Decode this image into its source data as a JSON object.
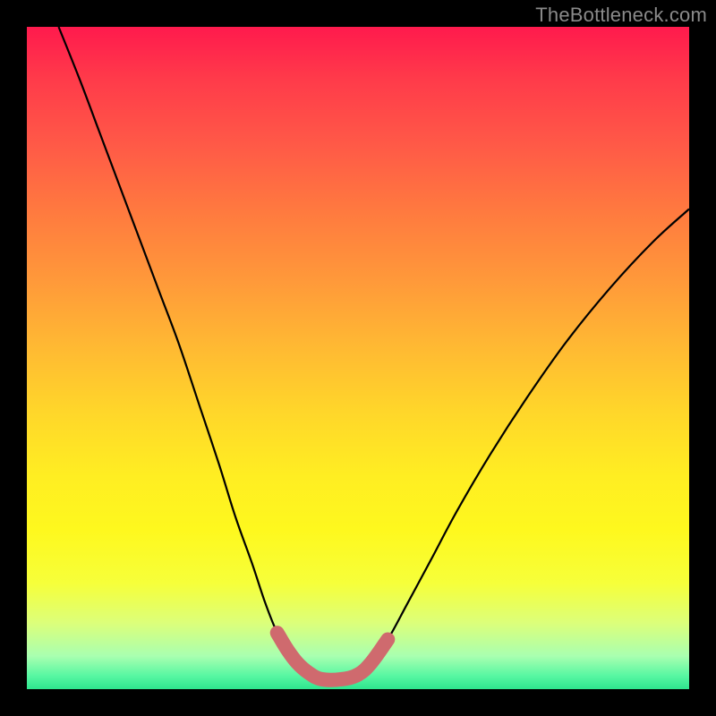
{
  "watermark": {
    "text": "TheBottleneck.com"
  },
  "chart_data": {
    "type": "line",
    "title": "",
    "xlabel": "",
    "ylabel": "",
    "xlim": [
      0,
      1
    ],
    "ylim": [
      0,
      1
    ],
    "series": [
      {
        "name": "curve",
        "color": "#000000",
        "width": 2.2,
        "points": [
          {
            "x": 0.048,
            "y": 1.0
          },
          {
            "x": 0.08,
            "y": 0.92
          },
          {
            "x": 0.11,
            "y": 0.84
          },
          {
            "x": 0.14,
            "y": 0.76
          },
          {
            "x": 0.17,
            "y": 0.68
          },
          {
            "x": 0.2,
            "y": 0.6
          },
          {
            "x": 0.23,
            "y": 0.52
          },
          {
            "x": 0.26,
            "y": 0.43
          },
          {
            "x": 0.29,
            "y": 0.34
          },
          {
            "x": 0.315,
            "y": 0.26
          },
          {
            "x": 0.34,
            "y": 0.19
          },
          {
            "x": 0.36,
            "y": 0.13
          },
          {
            "x": 0.378,
            "y": 0.085
          },
          {
            "x": 0.393,
            "y": 0.06
          },
          {
            "x": 0.408,
            "y": 0.04
          },
          {
            "x": 0.425,
            "y": 0.025
          },
          {
            "x": 0.445,
            "y": 0.015
          },
          {
            "x": 0.475,
            "y": 0.015
          },
          {
            "x": 0.5,
            "y": 0.022
          },
          {
            "x": 0.52,
            "y": 0.04
          },
          {
            "x": 0.545,
            "y": 0.075
          },
          {
            "x": 0.575,
            "y": 0.13
          },
          {
            "x": 0.61,
            "y": 0.195
          },
          {
            "x": 0.65,
            "y": 0.27
          },
          {
            "x": 0.7,
            "y": 0.355
          },
          {
            "x": 0.755,
            "y": 0.44
          },
          {
            "x": 0.815,
            "y": 0.525
          },
          {
            "x": 0.88,
            "y": 0.605
          },
          {
            "x": 0.945,
            "y": 0.675
          },
          {
            "x": 1.0,
            "y": 0.725
          }
        ]
      },
      {
        "name": "valley-highlight",
        "color": "#cf6a6e",
        "width": 16,
        "linecap": "round",
        "points": [
          {
            "x": 0.378,
            "y": 0.085
          },
          {
            "x": 0.393,
            "y": 0.06
          },
          {
            "x": 0.408,
            "y": 0.04
          },
          {
            "x": 0.425,
            "y": 0.025
          },
          {
            "x": 0.445,
            "y": 0.015
          },
          {
            "x": 0.475,
            "y": 0.015
          },
          {
            "x": 0.5,
            "y": 0.022
          },
          {
            "x": 0.52,
            "y": 0.04
          },
          {
            "x": 0.545,
            "y": 0.075
          }
        ]
      }
    ]
  }
}
